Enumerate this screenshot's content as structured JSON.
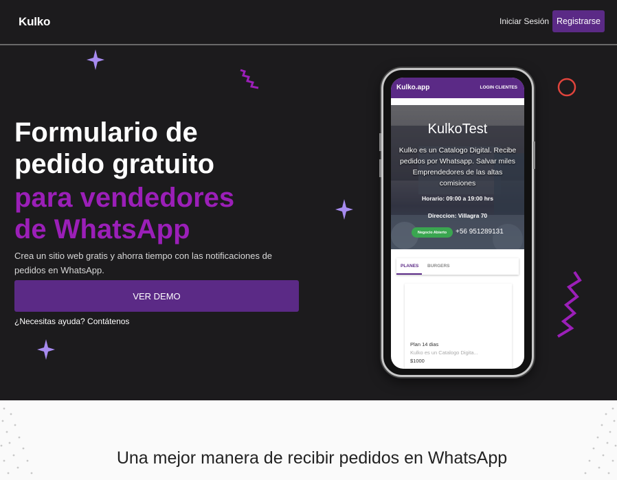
{
  "header": {
    "logo": "Kulko",
    "login_label": "Iniciar Sesión",
    "register_label": "Registrarse"
  },
  "hero": {
    "title_line1": "Formulario de",
    "title_line2": "pedido gratuito",
    "title_accent_line1": "para vendedores",
    "title_accent_line2": "de WhatsApp",
    "description": "Crea un sitio web gratis y ahorra tiempo con las notificaciones de pedidos en WhatsApp.",
    "demo_button": "VER DEMO",
    "help_link": "¿Necesitas ayuda? Contátenos"
  },
  "phone": {
    "app_title": "Kulko.app",
    "app_login": "LOGIN CLIENTES",
    "shop_title": "KulkoTest",
    "shop_description": "Kulko es un Catalogo Digital. Recibe pedidos por Whatsapp. Salvar miles Emprendedores de las altas comisiones",
    "hours": "Horario: 09:00 a 19:00 hrs",
    "address": "Direccion: Villagra 70",
    "status_badge": "Negocio Abierto",
    "phone_number": "+56 951289131",
    "tabs": [
      "PLANES",
      "BURGERS"
    ],
    "product": {
      "name": "Plan 14 dias",
      "description": "Kulko es un Catalogo Digita...",
      "price": "$1000"
    }
  },
  "section": {
    "title": "Una mejor manera de recibir pedidos en WhatsApp"
  },
  "colors": {
    "background_dark": "#1c1b1d",
    "brand_purple": "#5b2a86",
    "accent_magenta": "#9b1fb8",
    "sparkle_lavender": "#a78bf0",
    "ring_red": "#e0443c",
    "badge_green": "#3aa650"
  }
}
